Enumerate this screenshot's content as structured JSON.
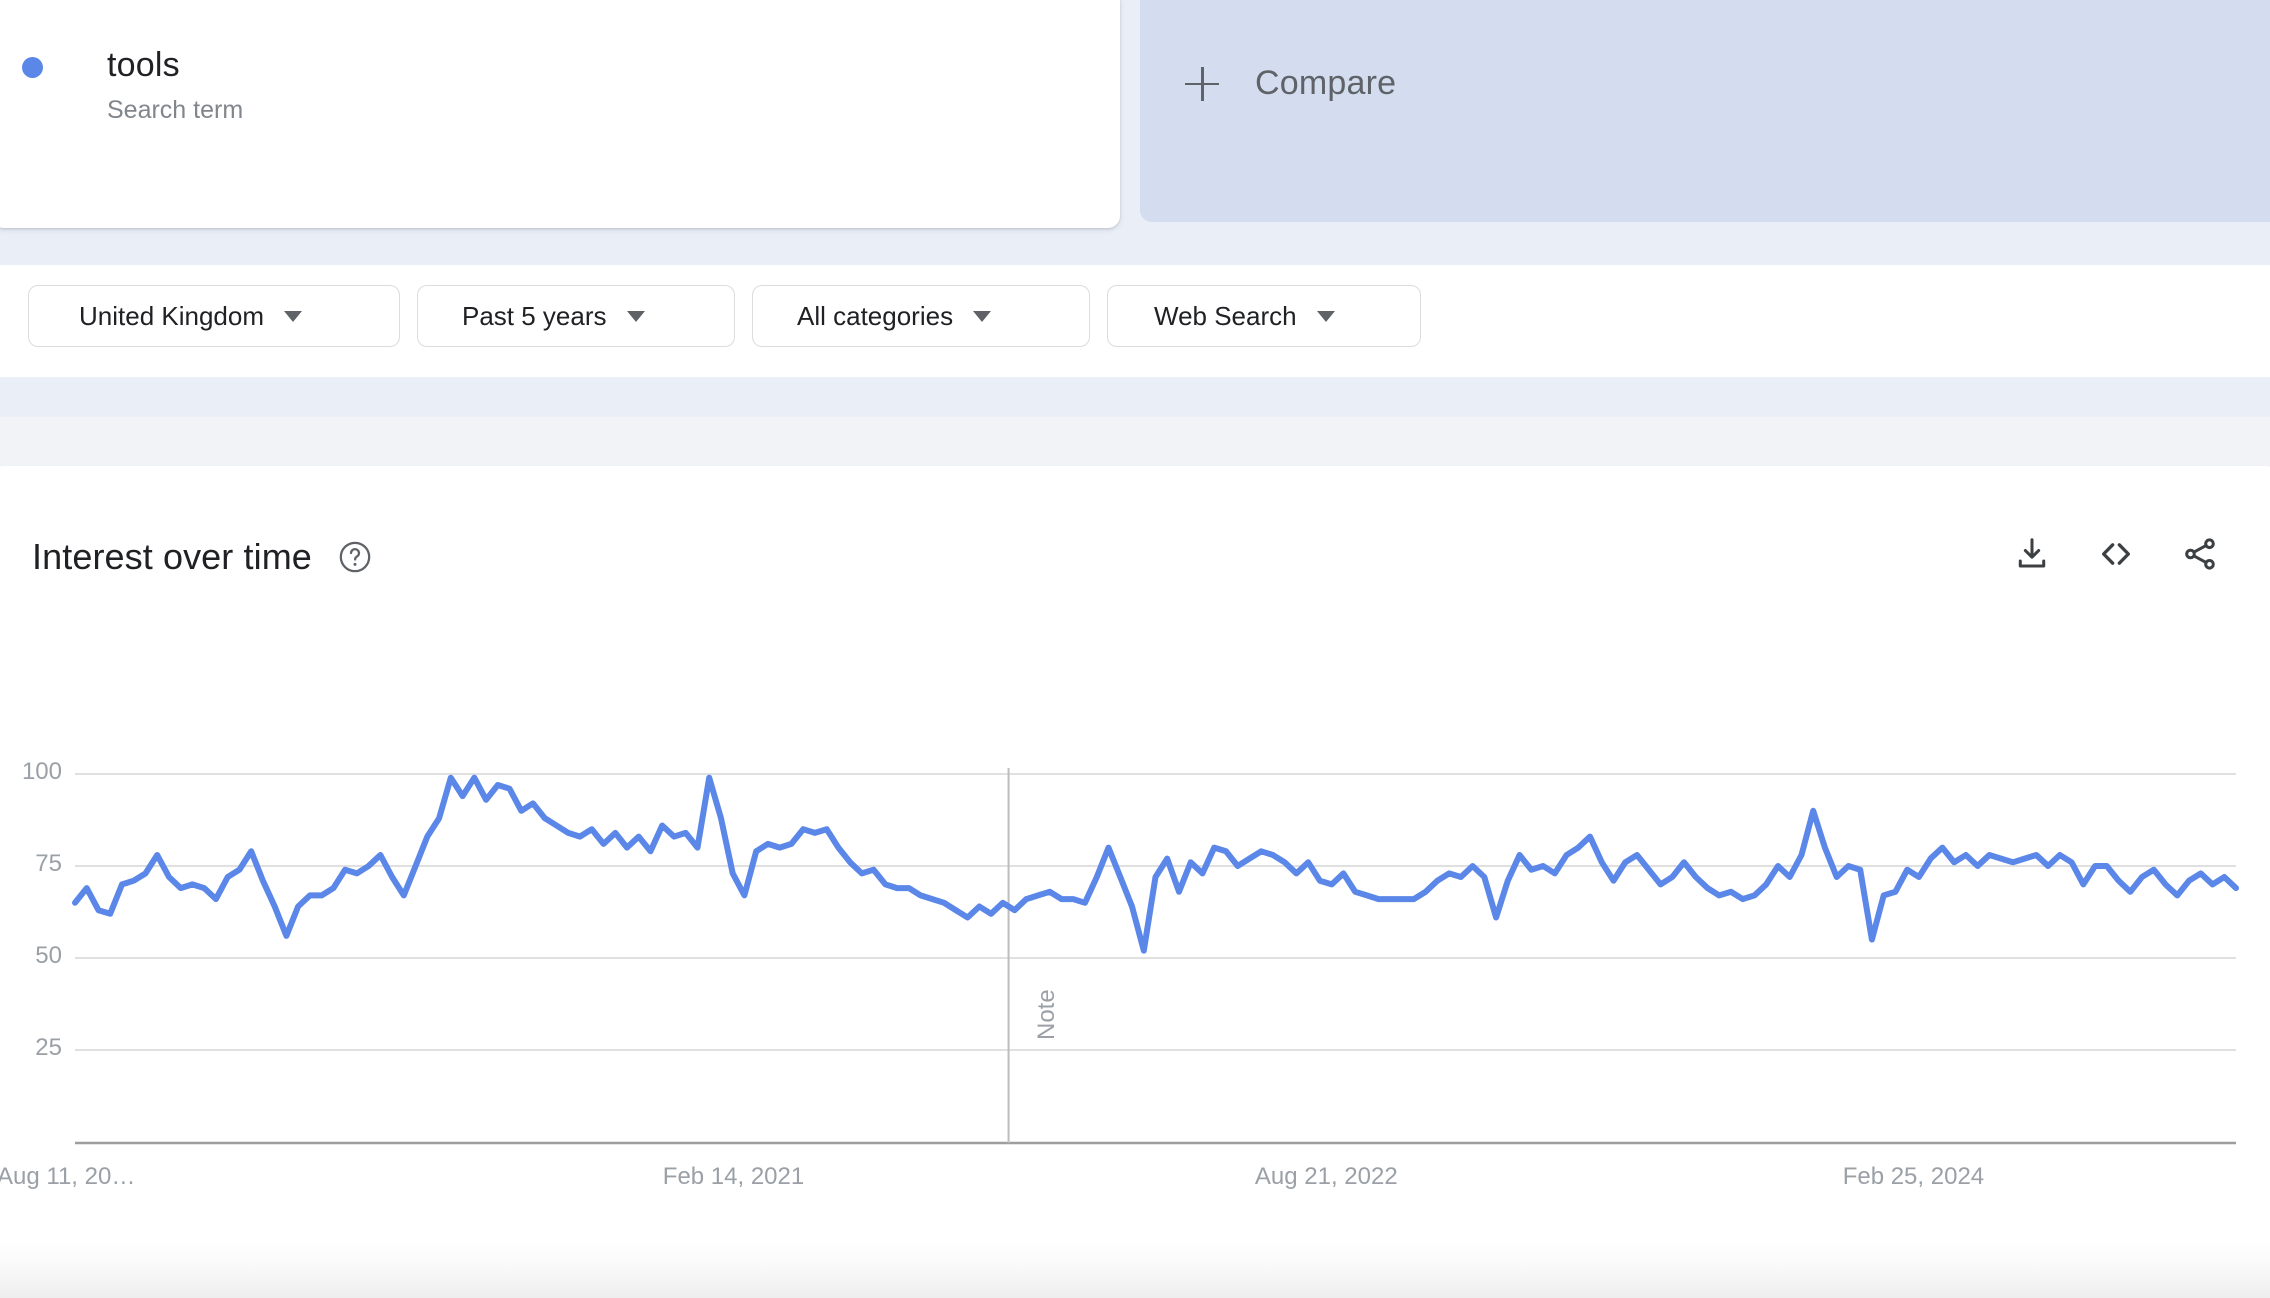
{
  "term": {
    "label": "tools",
    "type_label": "Search term",
    "dot_color": "#5b87e8"
  },
  "compare": {
    "label": "Compare",
    "icon": "plus-icon",
    "card_color": "#d3ddef"
  },
  "filters": [
    {
      "label": "United Kingdom",
      "icon": "chevron-down-icon"
    },
    {
      "label": "Past 5 years",
      "icon": "chevron-down-icon"
    },
    {
      "label": "All categories",
      "icon": "chevron-down-icon"
    },
    {
      "label": "Web Search",
      "icon": "chevron-down-icon"
    }
  ],
  "panel": {
    "title": "Interest over time",
    "help_icon": "help-circle-icon",
    "actions": [
      {
        "name": "download-icon",
        "tooltip": "Download"
      },
      {
        "name": "embed-code-icon",
        "tooltip": "Embed"
      },
      {
        "name": "share-icon",
        "tooltip": "Share"
      }
    ]
  },
  "chart_data": {
    "type": "line",
    "title": "Interest over time",
    "xlabel": "",
    "ylabel": "",
    "ylim": [
      0,
      110
    ],
    "yticks": [
      100,
      75,
      50,
      25
    ],
    "grid": true,
    "legend": "none",
    "line_color": "#5b87e8",
    "xticks": [
      {
        "label": "Aug 11, 20…",
        "pos": 0.0
      },
      {
        "label": "Feb 14, 2021",
        "pos": 0.272
      },
      {
        "label": "Aug 21, 2022",
        "pos": 0.546
      },
      {
        "label": "Feb 25, 2024",
        "pos": 0.818
      }
    ],
    "annotations": [
      {
        "label": "Note",
        "pos": 0.432,
        "type": "vertical-marker"
      }
    ],
    "series": [
      {
        "name": "tools",
        "values": [
          65,
          69,
          63,
          62,
          70,
          71,
          73,
          78,
          72,
          69,
          70,
          69,
          66,
          72,
          74,
          79,
          71,
          64,
          56,
          64,
          67,
          67,
          69,
          74,
          73,
          75,
          78,
          72,
          67,
          75,
          83,
          88,
          99,
          94,
          99,
          93,
          97,
          96,
          90,
          92,
          88,
          86,
          84,
          83,
          85,
          81,
          84,
          80,
          83,
          79,
          86,
          83,
          84,
          80,
          99,
          88,
          73,
          67,
          79,
          81,
          80,
          81,
          85,
          84,
          85,
          80,
          76,
          73,
          74,
          70,
          69,
          69,
          67,
          66,
          65,
          63,
          61,
          64,
          62,
          65,
          63,
          66,
          67,
          68,
          66,
          66,
          65,
          72,
          80,
          72,
          64,
          52,
          72,
          77,
          68,
          76,
          73,
          80,
          79,
          75,
          77,
          79,
          78,
          76,
          73,
          76,
          71,
          70,
          73,
          68,
          67,
          66,
          66,
          66,
          66,
          68,
          71,
          73,
          72,
          75,
          72,
          61,
          71,
          78,
          74,
          75,
          73,
          78,
          80,
          83,
          76,
          71,
          76,
          78,
          74,
          70,
          72,
          76,
          72,
          69,
          67,
          68,
          66,
          67,
          70,
          75,
          72,
          78,
          90,
          80,
          72,
          75,
          74,
          55,
          67,
          68,
          74,
          72,
          77,
          80,
          76,
          78,
          75,
          78,
          77,
          76,
          77,
          78,
          75,
          78,
          76,
          70,
          75,
          75,
          71,
          68,
          72,
          74,
          70,
          67,
          71,
          73,
          70,
          72,
          69
        ]
      }
    ]
  }
}
